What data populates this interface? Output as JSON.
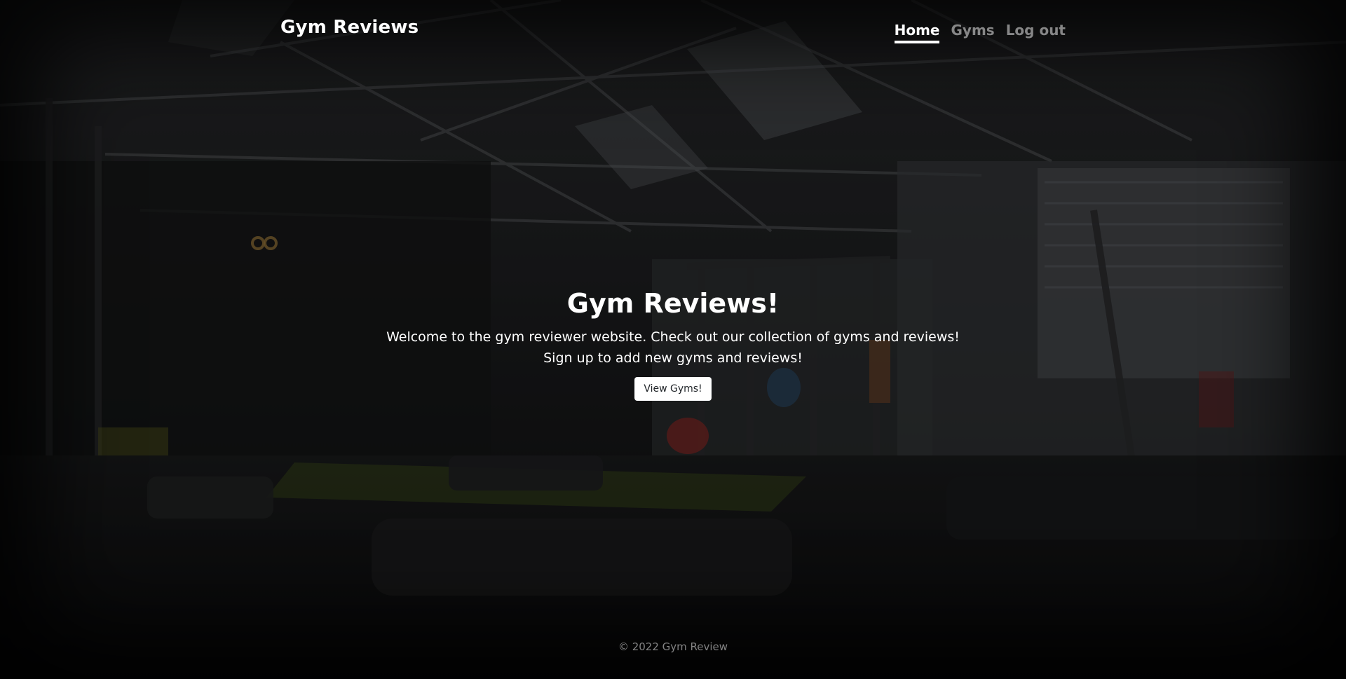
{
  "header": {
    "brand": "Gym Reviews",
    "nav": [
      {
        "label": "Home",
        "active": true
      },
      {
        "label": "Gyms",
        "active": false
      },
      {
        "label": "Log out",
        "active": false
      }
    ]
  },
  "hero": {
    "title": "Gym Reviews!",
    "line1": "Welcome to the gym reviewer website. Check out our collection of gyms and reviews!",
    "line2": "Sign up to add new gyms and reviews!",
    "button_label": "View Gyms!"
  },
  "footer": {
    "text": "© 2022 Gym Review"
  },
  "colors": {
    "text": "#ffffff",
    "muted_text": "#8a8a8a",
    "button_bg": "#ffffff",
    "button_text": "#212529"
  }
}
